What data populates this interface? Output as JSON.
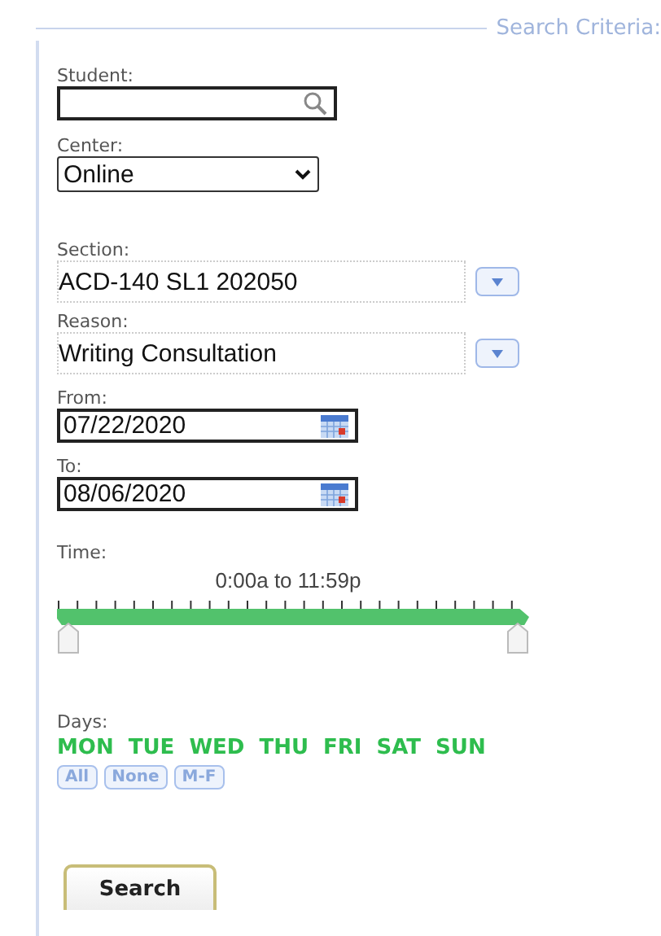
{
  "legend": "Search Criteria:",
  "student": {
    "label": "Student:"
  },
  "center": {
    "label": "Center:",
    "value": "Online"
  },
  "section": {
    "label": "Section:",
    "value": "ACD-140 SL1 202050"
  },
  "reason": {
    "label": "Reason:",
    "value": "Writing Consultation"
  },
  "from": {
    "label": "From:",
    "value": "07/22/2020"
  },
  "to": {
    "label": "To:",
    "value": "08/06/2020"
  },
  "time": {
    "label": "Time:",
    "reading": "0:00a to 11:59p"
  },
  "days": {
    "label": "Days:",
    "items": [
      {
        "label": "MON",
        "selected": true
      },
      {
        "label": "TUE",
        "selected": true
      },
      {
        "label": "WED",
        "selected": true
      },
      {
        "label": "THU",
        "selected": true
      },
      {
        "label": "FRI",
        "selected": true
      },
      {
        "label": "SAT",
        "selected": true
      },
      {
        "label": "SUN",
        "selected": true
      }
    ],
    "presets": [
      "All",
      "None",
      "M-F"
    ]
  },
  "submit": "Search"
}
